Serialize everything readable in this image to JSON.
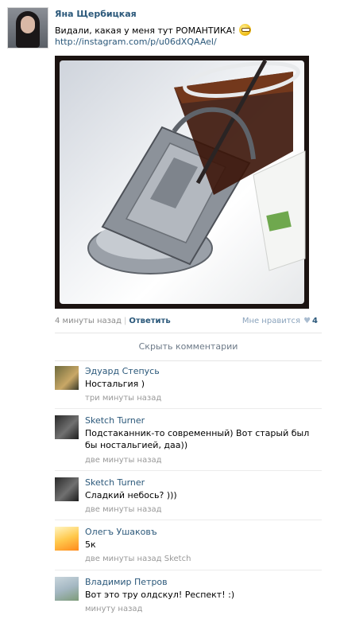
{
  "post": {
    "author": "Яна Щербицкая",
    "text": "Видали, какая у меня тут РОМАНТИКА!",
    "emoji_icon": "grin-smiley-icon",
    "link": "http://instagram.com/p/u06dXQAAel/",
    "time": "4 минуты назад",
    "reply_label": "Ответить",
    "like_label": "Мне нравится",
    "like_count": "4"
  },
  "hide_comments_label": "Скрыть комментарии",
  "comments": [
    {
      "author": "Эдуард Степусь",
      "text": "Ностальгия )",
      "time": "три минуты назад"
    },
    {
      "author": "Sketch Turner",
      "text": "Подстаканник-то современный) Вот старый был бы ностальгией, даа))",
      "time": "две минуты назад"
    },
    {
      "author": "Sketch Turner",
      "text": "Сладкий небось? )))",
      "time": "две минуты назад"
    },
    {
      "author": "Олегъ Ушаковъ",
      "text": "5к",
      "time": "две минуты назад Sketch"
    },
    {
      "author": "Владимир Петров",
      "text": "Вот это тру олдскул! Респект! :)",
      "time": "минуту назад"
    }
  ],
  "colors": {
    "link": "#2b587a",
    "meta": "#8a8a8a",
    "like_heart": "#a9bcd0"
  }
}
